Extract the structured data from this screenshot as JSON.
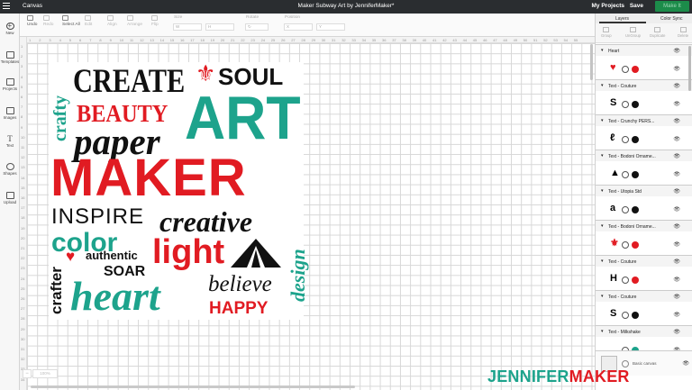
{
  "topbar": {
    "app_name": "Canvas",
    "doc_title": "Maker Subway Art by JenniferMaker*",
    "my_projects": "My Projects",
    "save": "Save",
    "make_it": "Make It"
  },
  "leftbar": [
    "New",
    "Templates",
    "Projects",
    "Images",
    "Text",
    "Shapes",
    "Upload"
  ],
  "toolbar": {
    "undo": "Undo",
    "redo": "Redo",
    "select_all": "Select All",
    "edit": "Edit",
    "align": "Align",
    "arrange": "Arrange",
    "flip": "Flip",
    "size_label": "Size",
    "w": "W",
    "h": "H",
    "rotate_label": "Rotate",
    "position_label": "Position",
    "x": "X",
    "y": "Y"
  },
  "ruler_top": [
    "1",
    "2",
    "3",
    "4",
    "5",
    "6",
    "7",
    "8",
    "9",
    "10",
    "11",
    "12",
    "13",
    "14",
    "15",
    "16",
    "17",
    "18",
    "19",
    "20",
    "21",
    "22",
    "23",
    "24",
    "25",
    "26",
    "27",
    "28",
    "29",
    "30",
    "31",
    "32",
    "33",
    "34",
    "35",
    "36",
    "37",
    "38",
    "39",
    "40",
    "41",
    "42",
    "43",
    "44",
    "45",
    "46",
    "47",
    "48",
    "49",
    "50",
    "51",
    "52",
    "53",
    "54",
    "55"
  ],
  "ruler_left": [
    "1",
    "2",
    "3",
    "4",
    "5",
    "6",
    "7",
    "8",
    "9",
    "10",
    "11",
    "12",
    "13",
    "14",
    "15",
    "16",
    "17",
    "18",
    "19",
    "20",
    "21",
    "22",
    "23",
    "24",
    "25",
    "26",
    "27",
    "28",
    "29",
    "30",
    "31",
    "32",
    "33",
    "34"
  ],
  "zoom": "100%",
  "art": {
    "crafty": "crafty",
    "create": "CREATE",
    "soul": "SOUL",
    "beauty": "BEAUTY",
    "art": "ART",
    "paper": "paper",
    "maker": "MAKER",
    "inspire": "INSPIRE",
    "creative": "creative",
    "color": "color",
    "authentic": "authentic",
    "light": "light",
    "crafter": "crafter",
    "soar": "SOAR",
    "heart": "heart",
    "believe": "believe",
    "happy": "HAPPY",
    "design": "design"
  },
  "panel": {
    "tabs": [
      "Layers",
      "Color Sync"
    ],
    "tools": [
      "Group",
      "UnGroup",
      "Duplicate",
      "Delete"
    ],
    "layers": [
      {
        "name": "Heart",
        "preview": "heart-shape",
        "color": "#e11b22"
      },
      {
        "name": "Text - Couture",
        "preview": "S",
        "color": "#111111"
      },
      {
        "name": "Text - Crunchy PERS...",
        "preview": "ℓ",
        "color": "#111111"
      },
      {
        "name": "Text - Bodoni Orname...",
        "preview": "tent",
        "color": "#111111"
      },
      {
        "name": "Text - Utopia Std",
        "preview": "a",
        "color": "#111111"
      },
      {
        "name": "Text - Bodoni Orname...",
        "preview": "fleur",
        "color": "#e11b22"
      },
      {
        "name": "Text - Couture",
        "preview": "H",
        "color": "#e11b22"
      },
      {
        "name": "Text - Couture",
        "preview": "S",
        "color": "#111111"
      },
      {
        "name": "Text - Milkshake",
        "preview": "",
        "color": "#1da38c"
      }
    ],
    "basic_canvas": "Basic canvas"
  },
  "watermark": {
    "part1": "JENNIFER",
    "part2": "MAKER"
  },
  "colors": {
    "red": "#e11b22",
    "teal": "#1da38c",
    "black": "#111111"
  }
}
